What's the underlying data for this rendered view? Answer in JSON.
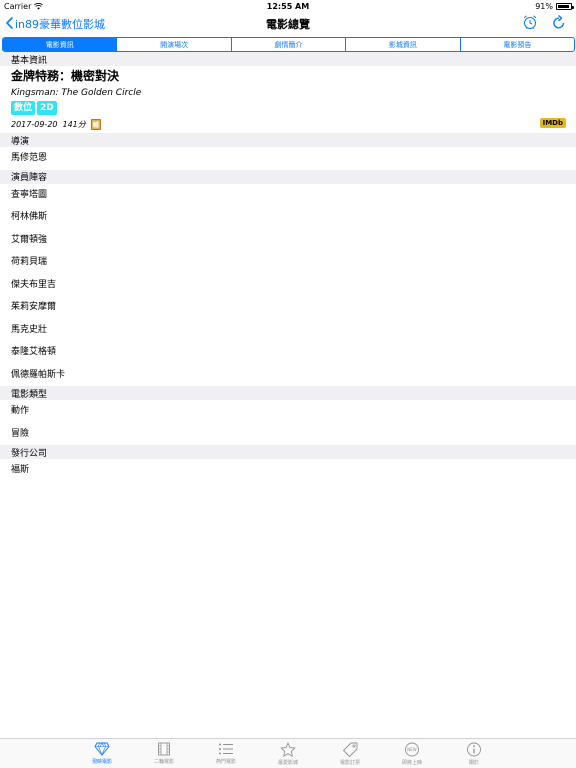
{
  "status": {
    "carrier": "Carrier",
    "time": "12:55 AM",
    "battery": "91%",
    "battery_level": 0.91
  },
  "nav": {
    "back_label": "in89豪華數位影城",
    "title": "電影總覽"
  },
  "segments": [
    "電影資訊",
    "開演場次",
    "劇情簡介",
    "影城資訊",
    "電影預告"
  ],
  "sections": {
    "basic": "基本資訊",
    "director": "導演",
    "cast": "演員陣容",
    "genre": "電影類型",
    "distributor": "發行公司"
  },
  "movie": {
    "title": "金牌特務：機密對決",
    "title_en": "Kingsman: The Golden Circle",
    "badges": [
      "數位",
      "2D"
    ],
    "release_date": "2017-09-20",
    "runtime": "141分",
    "rating_icon": "rating-icon",
    "imdb_label": "IMDb"
  },
  "director": [
    "馬修范恩"
  ],
  "cast": [
    "查寧塔圖",
    "柯林佛斯",
    "艾爾頓強",
    "荷莉貝瑞",
    "傑夫布里吉",
    "茱莉安摩爾",
    "馬克史壯",
    "泰隆艾格頓",
    "佩德羅帕斯卡"
  ],
  "genres": [
    "動作",
    "冒險"
  ],
  "distributor": [
    "福斯"
  ],
  "tabs": [
    {
      "label": "現映電影",
      "icon": "diamond-icon",
      "active": true
    },
    {
      "label": "二輪電影",
      "icon": "film-icon",
      "active": false
    },
    {
      "label": "熱門電影",
      "icon": "list-icon",
      "active": false
    },
    {
      "label": "最愛影城",
      "icon": "star-icon",
      "active": false
    },
    {
      "label": "電影訂票",
      "icon": "tag-icon",
      "active": false
    },
    {
      "label": "即將上映",
      "icon": "new-icon",
      "active": false
    },
    {
      "label": "關於",
      "icon": "info-icon",
      "active": false
    }
  ],
  "colors": {
    "accent": "#0a7aff",
    "badge": "#2ee6f2",
    "imdb": "#e5b81c",
    "section_bg": "#efeff4"
  }
}
